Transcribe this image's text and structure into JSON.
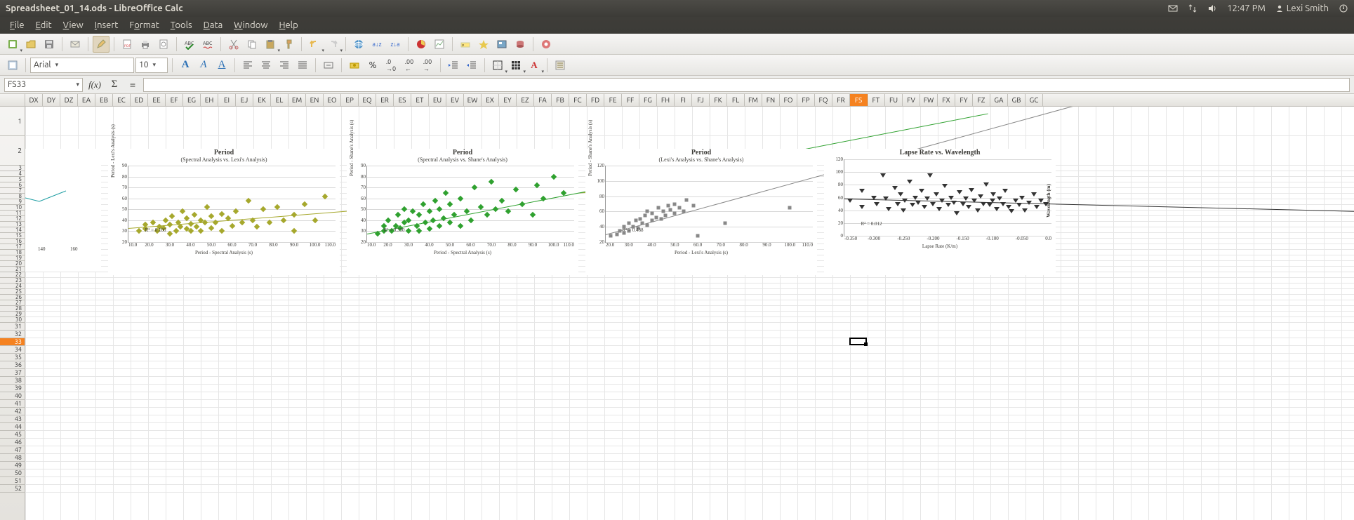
{
  "system": {
    "title": "Spreadsheet_01_14.ods - LibreOffice Calc",
    "time": "12:47 PM",
    "user": "Lexi Smith"
  },
  "menu": {
    "file": "File",
    "edit": "Edit",
    "view": "View",
    "insert": "Insert",
    "format": "Format",
    "tools": "Tools",
    "data": "Data",
    "window": "Window",
    "help": "Help"
  },
  "format_bar": {
    "font_name": "Arial",
    "font_size": "10"
  },
  "formula": {
    "cell_ref": "FS33",
    "fx": "f(x)",
    "sigma": "Σ",
    "eq": "=",
    "value": ""
  },
  "columns": [
    "DX",
    "DY",
    "DZ",
    "EA",
    "EB",
    "EC",
    "ED",
    "EE",
    "EF",
    "EG",
    "EH",
    "EI",
    "EJ",
    "EK",
    "EL",
    "EM",
    "EN",
    "EO",
    "EP",
    "EQ",
    "ER",
    "ES",
    "ET",
    "EU",
    "EV",
    "EW",
    "EX",
    "EY",
    "EZ",
    "FA",
    "FB",
    "FC",
    "FD",
    "FE",
    "FF",
    "FG",
    "FH",
    "FI",
    "FJ",
    "FK",
    "FL",
    "FM",
    "FN",
    "FO",
    "FP",
    "FQ",
    "FR",
    "FS",
    "FT",
    "FU",
    "FV",
    "FW",
    "FX",
    "FY",
    "FZ",
    "GA",
    "GB",
    "GC"
  ],
  "selected_col": "FS",
  "selected_row": 33,
  "row_heights": {
    "1": 42,
    "2": 42
  },
  "chart_data": [
    {
      "id": "chart1",
      "title": "Period",
      "subtitle": "(Spectral Analysis vs. Lexi's Analysis)",
      "xlabel": "Period - Spectral Analysis (s)",
      "ylabel": "Period - Lexi's Analysis (s)",
      "type": "scatter",
      "color": "#a6a82d",
      "marker": "diamond",
      "xlim": [
        10,
        110
      ],
      "xticks": [
        10,
        20,
        30,
        40,
        50,
        60,
        70,
        80,
        90,
        100,
        110
      ],
      "ylim": [
        20,
        90
      ],
      "yticks": [
        20,
        30,
        40,
        50,
        60,
        70,
        80,
        90
      ],
      "r2_label": "R² = 0.100",
      "trend": {
        "x1": 10,
        "y1": 33,
        "x2": 110,
        "y2": 48
      },
      "points": [
        [
          15,
          30
        ],
        [
          18,
          32
        ],
        [
          18,
          36
        ],
        [
          22,
          38
        ],
        [
          24,
          30
        ],
        [
          25,
          34
        ],
        [
          27,
          33
        ],
        [
          28,
          40
        ],
        [
          30,
          28
        ],
        [
          30,
          36
        ],
        [
          31,
          44
        ],
        [
          33,
          30
        ],
        [
          34,
          38
        ],
        [
          35,
          34
        ],
        [
          36,
          48
        ],
        [
          38,
          32
        ],
        [
          38,
          42
        ],
        [
          40,
          30
        ],
        [
          40,
          37
        ],
        [
          42,
          45
        ],
        [
          43,
          34
        ],
        [
          45,
          30
        ],
        [
          45,
          40
        ],
        [
          47,
          38
        ],
        [
          48,
          52
        ],
        [
          50,
          33
        ],
        [
          50,
          44
        ],
        [
          52,
          38
        ],
        [
          55,
          30
        ],
        [
          55,
          46
        ],
        [
          58,
          42
        ],
        [
          60,
          35
        ],
        [
          62,
          48
        ],
        [
          65,
          38
        ],
        [
          68,
          58
        ],
        [
          70,
          40
        ],
        [
          72,
          34
        ],
        [
          75,
          50
        ],
        [
          78,
          38
        ],
        [
          82,
          52
        ],
        [
          85,
          40
        ],
        [
          90,
          30
        ],
        [
          90,
          45
        ],
        [
          95,
          55
        ],
        [
          100,
          40
        ],
        [
          105,
          62
        ]
      ]
    },
    {
      "id": "chart2",
      "title": "Period",
      "subtitle": "(Spectral Analysis vs. Shane's Analysis)",
      "xlabel": "Period - Spectral Analysis (s)",
      "ylabel": "Period - Shane's Analysis (s)",
      "type": "scatter",
      "color": "#2fa12f",
      "marker": "diamond",
      "xlim": [
        10,
        110
      ],
      "xticks": [
        10,
        20,
        30,
        40,
        50,
        60,
        70,
        80,
        90,
        100,
        110
      ],
      "ylim": [
        20,
        90
      ],
      "yticks": [
        20,
        30,
        40,
        50,
        60,
        70,
        80,
        90
      ],
      "r2_label": "R² = 0.330",
      "trend": {
        "x1": 10,
        "y1": 28,
        "x2": 110,
        "y2": 65
      },
      "points": [
        [
          15,
          28
        ],
        [
          18,
          30
        ],
        [
          18,
          35
        ],
        [
          20,
          40
        ],
        [
          22,
          30
        ],
        [
          24,
          35
        ],
        [
          25,
          45
        ],
        [
          26,
          33
        ],
        [
          28,
          38
        ],
        [
          28,
          50
        ],
        [
          30,
          30
        ],
        [
          30,
          40
        ],
        [
          32,
          48
        ],
        [
          34,
          35
        ],
        [
          35,
          30
        ],
        [
          35,
          45
        ],
        [
          37,
          55
        ],
        [
          38,
          38
        ],
        [
          40,
          32
        ],
        [
          40,
          48
        ],
        [
          42,
          40
        ],
        [
          43,
          58
        ],
        [
          45,
          35
        ],
        [
          45,
          50
        ],
        [
          47,
          42
        ],
        [
          48,
          65
        ],
        [
          50,
          38
        ],
        [
          50,
          55
        ],
        [
          52,
          45
        ],
        [
          55,
          35
        ],
        [
          55,
          60
        ],
        [
          58,
          48
        ],
        [
          60,
          40
        ],
        [
          62,
          70
        ],
        [
          65,
          52
        ],
        [
          68,
          45
        ],
        [
          70,
          75
        ],
        [
          72,
          50
        ],
        [
          75,
          58
        ],
        [
          78,
          48
        ],
        [
          82,
          68
        ],
        [
          85,
          55
        ],
        [
          90,
          45
        ],
        [
          92,
          72
        ],
        [
          95,
          60
        ],
        [
          100,
          80
        ],
        [
          105,
          65
        ]
      ]
    },
    {
      "id": "chart3",
      "title": "Period",
      "subtitle": "(Lexi's Analysis vs. Shane's Analysis)",
      "xlabel": "Period - Lexi's Analysis (s)",
      "ylabel": "Period - Shane's Analysis (s)",
      "type": "scatter",
      "color": "#888888",
      "marker": "square",
      "xlim": [
        20,
        110
      ],
      "xticks": [
        20,
        30,
        40,
        50,
        60,
        70,
        80,
        90,
        100,
        110
      ],
      "ylim": [
        20,
        120
      ],
      "yticks": [
        20,
        40,
        60,
        80,
        100,
        120
      ],
      "r2_label": "R² = 0.488",
      "trend": {
        "x1": 20,
        "y1": 30,
        "x2": 110,
        "y2": 105
      },
      "points": [
        [
          22,
          28
        ],
        [
          25,
          30
        ],
        [
          26,
          35
        ],
        [
          28,
          32
        ],
        [
          28,
          40
        ],
        [
          30,
          35
        ],
        [
          30,
          45
        ],
        [
          32,
          40
        ],
        [
          33,
          48
        ],
        [
          34,
          38
        ],
        [
          35,
          50
        ],
        [
          36,
          45
        ],
        [
          37,
          55
        ],
        [
          38,
          42
        ],
        [
          38,
          60
        ],
        [
          40,
          48
        ],
        [
          40,
          58
        ],
        [
          42,
          52
        ],
        [
          43,
          65
        ],
        [
          44,
          50
        ],
        [
          45,
          60
        ],
        [
          46,
          55
        ],
        [
          47,
          68
        ],
        [
          48,
          62
        ],
        [
          50,
          58
        ],
        [
          50,
          70
        ],
        [
          52,
          65
        ],
        [
          54,
          60
        ],
        [
          55,
          75
        ],
        [
          58,
          68
        ],
        [
          60,
          28
        ],
        [
          72,
          45
        ],
        [
          100,
          65
        ]
      ]
    },
    {
      "id": "chart4",
      "title": "Lapse Rate vs. Wavelength",
      "subtitle": "",
      "xlabel": "Lapse Rate (K/m)",
      "ylabel": "",
      "ylabel2": "Wavelength (m)",
      "type": "scatter",
      "color": "#333333",
      "marker": "tri",
      "xlim": [
        -0.35,
        0.0
      ],
      "xticks": [
        -0.35,
        -0.3,
        -0.25,
        -0.2,
        -0.15,
        -0.1,
        -0.05,
        0.0
      ],
      "ylim": [
        0,
        120
      ],
      "yticks": [
        0,
        20,
        40,
        60,
        80,
        100,
        120
      ],
      "r2_label": "R² = 0.012",
      "trend": {
        "x1": -0.35,
        "y1": 58,
        "x2": 0.0,
        "y2": 50
      },
      "points": [
        [
          -0.34,
          55
        ],
        [
          -0.32,
          70
        ],
        [
          -0.32,
          45
        ],
        [
          -0.3,
          60
        ],
        [
          -0.295,
          50
        ],
        [
          -0.285,
          95
        ],
        [
          -0.28,
          58
        ],
        [
          -0.275,
          42
        ],
        [
          -0.265,
          75
        ],
        [
          -0.26,
          50
        ],
        [
          -0.255,
          65
        ],
        [
          -0.25,
          40
        ],
        [
          -0.248,
          55
        ],
        [
          -0.24,
          85
        ],
        [
          -0.235,
          48
        ],
        [
          -0.23,
          60
        ],
        [
          -0.225,
          52
        ],
        [
          -0.22,
          70
        ],
        [
          -0.215,
          45
        ],
        [
          -0.21,
          58
        ],
        [
          -0.205,
          95
        ],
        [
          -0.2,
          50
        ],
        [
          -0.195,
          65
        ],
        [
          -0.19,
          42
        ],
        [
          -0.185,
          55
        ],
        [
          -0.18,
          78
        ],
        [
          -0.175,
          48
        ],
        [
          -0.17,
          60
        ],
        [
          -0.165,
          52
        ],
        [
          -0.16,
          35
        ],
        [
          -0.155,
          68
        ],
        [
          -0.15,
          50
        ],
        [
          -0.145,
          58
        ],
        [
          -0.14,
          45
        ],
        [
          -0.135,
          72
        ],
        [
          -0.13,
          55
        ],
        [
          -0.125,
          40
        ],
        [
          -0.12,
          62
        ],
        [
          -0.115,
          50
        ],
        [
          -0.11,
          80
        ],
        [
          -0.105,
          48
        ],
        [
          -0.1,
          55
        ],
        [
          -0.098,
          65
        ],
        [
          -0.092,
          42
        ],
        [
          -0.088,
          58
        ],
        [
          -0.082,
          50
        ],
        [
          -0.078,
          70
        ],
        [
          -0.072,
          45
        ],
        [
          -0.068,
          38
        ],
        [
          -0.06,
          55
        ],
        [
          -0.055,
          48
        ],
        [
          -0.05,
          60
        ],
        [
          -0.045,
          40
        ],
        [
          -0.038,
          52
        ],
        [
          -0.03,
          65
        ],
        [
          -0.025,
          45
        ],
        [
          -0.018,
          55
        ],
        [
          -0.01,
          50
        ]
      ]
    }
  ],
  "mini_chart": {
    "xticks": [
      "140",
      "160"
    ]
  }
}
